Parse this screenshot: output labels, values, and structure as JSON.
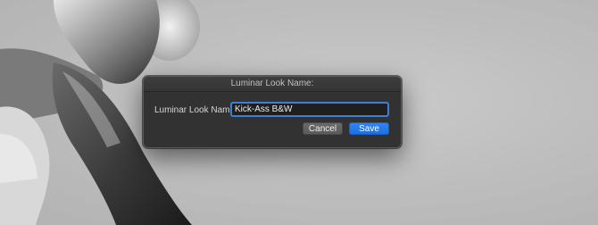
{
  "background": {
    "description_icon": "grayscale-dancer-photo"
  },
  "dialog": {
    "title": "Luminar Look Name:",
    "field_label": "Luminar Look Name:",
    "field_value": "Kick-Ass B&W",
    "cancel_label": "Cancel",
    "save_label": "Save",
    "accent_color": "#2f7ae5",
    "focus_ring_color": "#3d7fd4"
  }
}
